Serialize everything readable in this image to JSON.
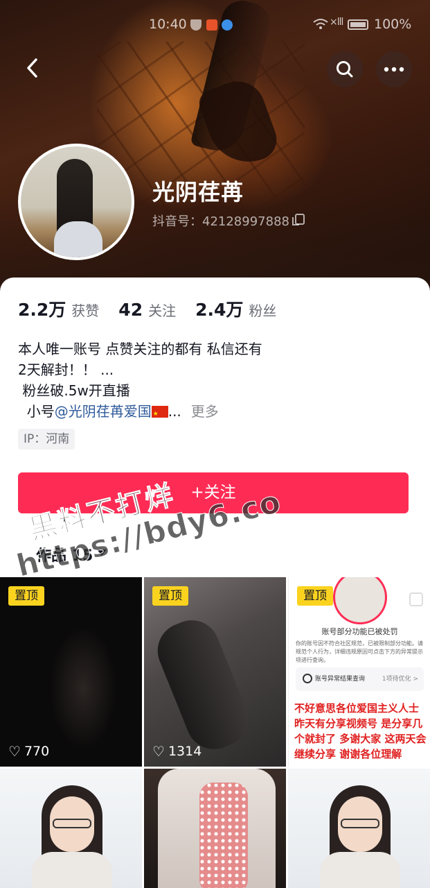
{
  "status_bar": {
    "time": "10:40",
    "battery": "100%",
    "signal": "×lll"
  },
  "profile": {
    "nickname": "光阴荏苒",
    "douyin_id": "抖音号：42128997888"
  },
  "stats": [
    {
      "value": "2.2万",
      "label": "获赞"
    },
    {
      "value": "42",
      "label": "关注"
    },
    {
      "value": "2.4万",
      "label": "粉丝"
    }
  ],
  "bio": {
    "line1": "本人唯一账号 点赞关注的都有 私信还有",
    "line2": "2天解封！！ ...",
    "line3": " 粉丝破.5w开直播",
    "line4_prefix": "  小号",
    "line4_mention": "@光阴荏苒爱国",
    "line4_suffix": "...",
    "more": "更多"
  },
  "ip": "IP：河南",
  "follow_button": "+关注",
  "works_tab": "作品 15",
  "watermark": {
    "line1": "黑料不打烊",
    "line2": "https://bdy6.co"
  },
  "videos": [
    {
      "pinned_label": "置顶",
      "likes": "770"
    },
    {
      "pinned_label": "置顶",
      "likes": "1314"
    },
    {
      "pinned_label": "置顶",
      "notice_title": "账号部分功能已被处罚",
      "notice_body": "你的账号因不符合社区规范，已被限制部分功能。请规范个人行为，详细违规原因可点击下方的异常提示项进行查询。",
      "notice_row": "账号异常结果查询",
      "notice_row_right": "1项待优化 >",
      "overlay_text": "不好意思各位爱国主义人士 昨天有分享视频号 是分享几个就封了 多谢大家 这两天会继续分享 谢谢各位理解"
    },
    {},
    {},
    {}
  ],
  "colors": {
    "accent": "#fe2c55",
    "pin": "#fbd31f",
    "mention": "#2f5a9b"
  }
}
